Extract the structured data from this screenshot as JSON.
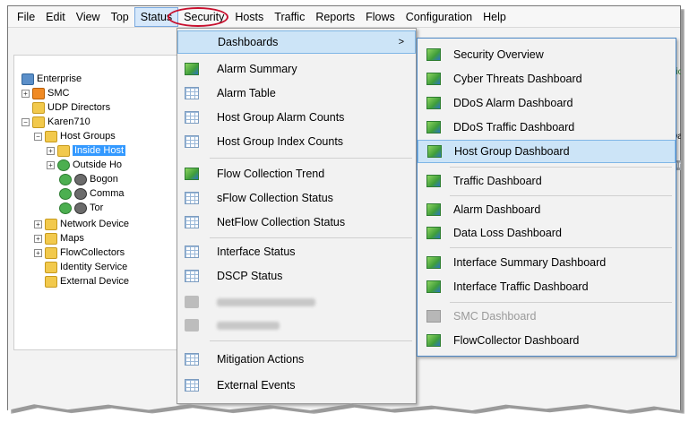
{
  "menubar": {
    "items": [
      "File",
      "Edit",
      "View",
      "Top",
      "Status",
      "Security",
      "Hosts",
      "Traffic",
      "Reports",
      "Flows",
      "Configuration",
      "Help"
    ],
    "active_index": 4
  },
  "tree": {
    "nodes": [
      {
        "label": "Enterprise",
        "icon": "enterprise-icon"
      },
      {
        "label": "SMC",
        "icon": "smc-icon"
      },
      {
        "label": "UDP Directors",
        "icon": "folder-icon"
      },
      {
        "label": "Karen710",
        "icon": "folder-icon"
      },
      {
        "label": "Host Groups",
        "icon": "folder-icon"
      },
      {
        "label": "Inside Host",
        "icon": "folder-icon",
        "selected": true
      },
      {
        "label": "Outside Ho",
        "icon": "globe-icon"
      },
      {
        "label": "Bogon",
        "icon": "pirate-icon"
      },
      {
        "label": "Comma",
        "icon": "pirate-icon"
      },
      {
        "label": "Tor",
        "icon": "pirate-icon"
      },
      {
        "label": "Network Device",
        "icon": "folder-icon"
      },
      {
        "label": "Maps",
        "icon": "folder-icon"
      },
      {
        "label": "FlowCollectors",
        "icon": "folder-icon"
      },
      {
        "label": "Identity Service",
        "icon": "folder-icon"
      },
      {
        "label": "External Device",
        "icon": "folder-icon"
      }
    ]
  },
  "background_window": {
    "fragments": [
      "ffic",
      "Da",
      "mm"
    ]
  },
  "status_menu": {
    "items": [
      {
        "label": "Dashboards",
        "icon": "none",
        "highlight": true,
        "submenu_arrow": ">"
      },
      {
        "label": "Alarm Summary",
        "icon": "chart-icon"
      },
      {
        "label": "Alarm Table",
        "icon": "table-icon"
      },
      {
        "label": "Host Group Alarm Counts",
        "icon": "table-icon"
      },
      {
        "label": "Host Group Index Counts",
        "icon": "table-icon"
      },
      {
        "label": "Flow Collection Trend",
        "icon": "chart-icon"
      },
      {
        "label": "sFlow Collection Status",
        "icon": "table-icon"
      },
      {
        "label": "NetFlow Collection Status",
        "icon": "table-icon"
      },
      {
        "label": "Interface Status",
        "icon": "table-icon"
      },
      {
        "label": "DSCP Status",
        "icon": "table-icon"
      },
      {
        "label": "",
        "icon": "blurred-icon",
        "blurred": true
      },
      {
        "label": "",
        "icon": "blurred-icon",
        "blurred": true
      },
      {
        "label": "Mitigation Actions",
        "icon": "table-icon"
      },
      {
        "label": "External Events",
        "icon": "table-icon"
      }
    ]
  },
  "dashboards_menu": {
    "items": [
      {
        "label": "Security Overview",
        "icon": "chart-icon"
      },
      {
        "label": "Cyber Threats Dashboard",
        "icon": "chart-icon"
      },
      {
        "label": "DDoS Alarm Dashboard",
        "icon": "chart-icon"
      },
      {
        "label": "DDoS Traffic Dashboard",
        "icon": "chart-icon"
      },
      {
        "label": "Host Group Dashboard",
        "icon": "chart-icon",
        "highlight": true
      },
      {
        "label": "Traffic Dashboard",
        "icon": "chart-icon"
      },
      {
        "label": "Alarm Dashboard",
        "icon": "chart-icon"
      },
      {
        "label": "Data Loss Dashboard",
        "icon": "chart-icon"
      },
      {
        "label": "Interface Summary Dashboard",
        "icon": "chart-icon"
      },
      {
        "label": "Interface Traffic Dashboard",
        "icon": "chart-icon"
      },
      {
        "label": "SMC Dashboard",
        "icon": "chart-icon",
        "disabled": true
      },
      {
        "label": "FlowCollector Dashboard",
        "icon": "chart-icon"
      }
    ]
  },
  "colors": {
    "menu_highlight": "#cce4f7",
    "selection": "#3399ff",
    "annotation_circle": "#c8102e"
  }
}
